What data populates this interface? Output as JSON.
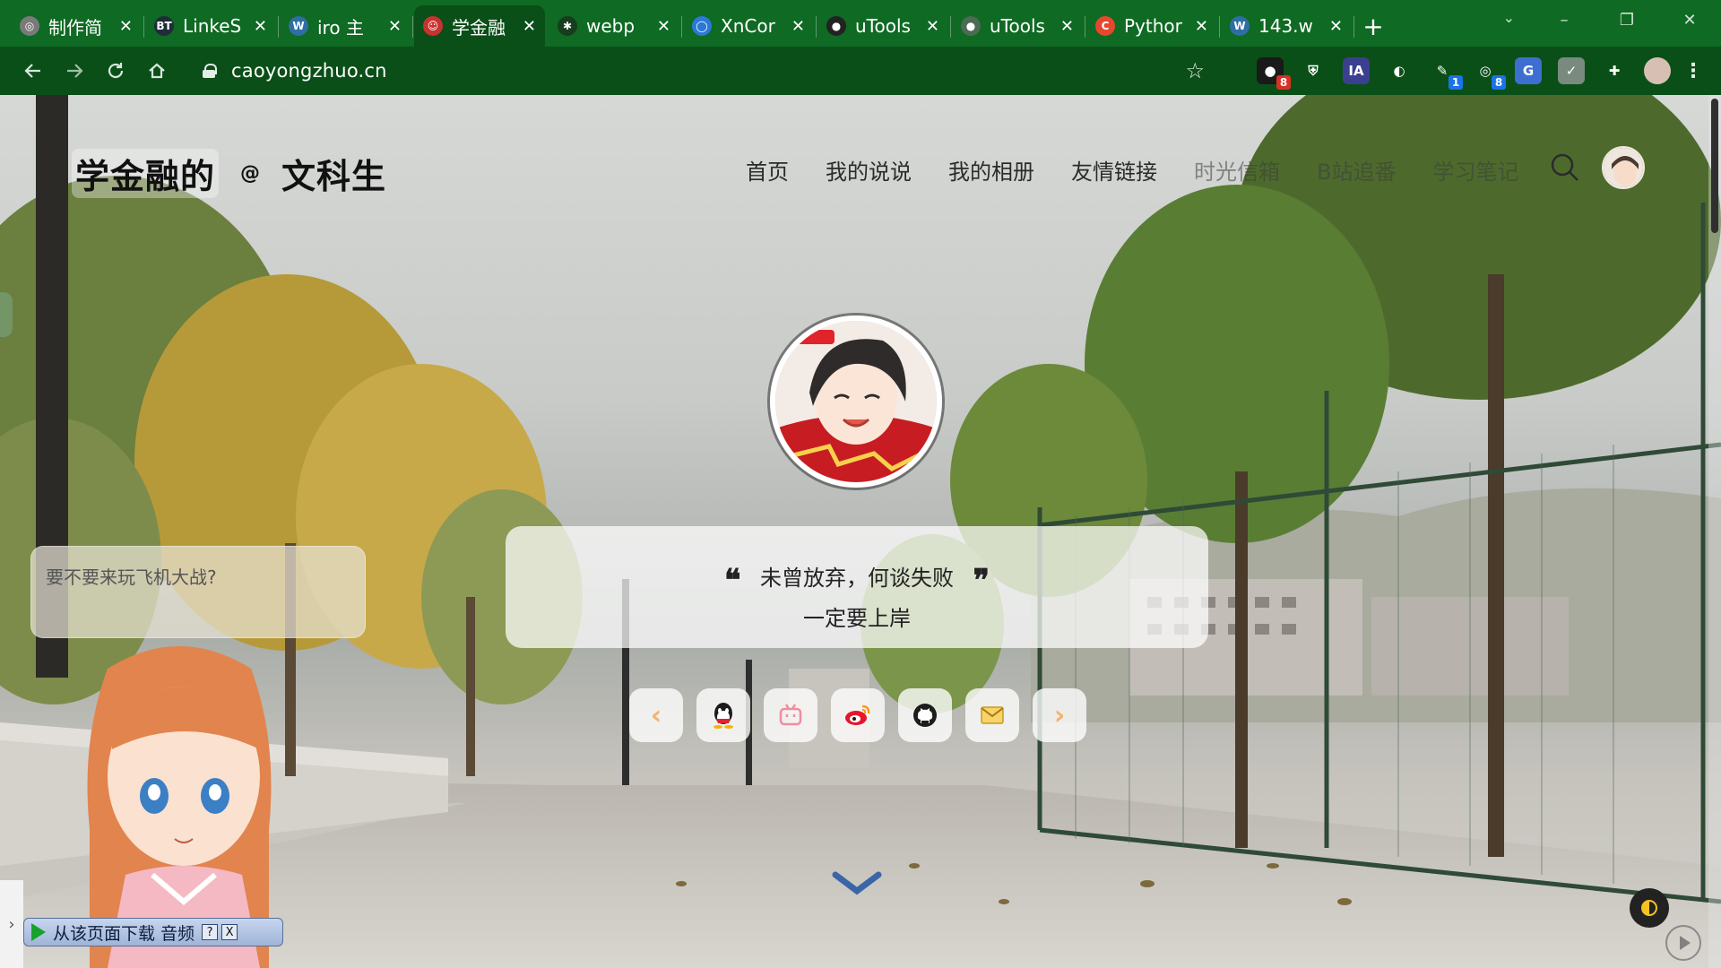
{
  "browser": {
    "tabs": [
      {
        "label": "制作简",
        "favicon": "globe-icon",
        "color": "#7a7a7a"
      },
      {
        "label": "LinkeS",
        "favicon": "bt-icon",
        "color": "#1f2d3a"
      },
      {
        "label": "iro 主",
        "favicon": "wordpress-icon",
        "color": "#2f6ea3"
      },
      {
        "label": "学金融",
        "favicon": "avatar-icon",
        "color": "#c8322f",
        "active": true
      },
      {
        "label": "webp",
        "favicon": "chain-icon",
        "color": "#173d1f"
      },
      {
        "label": "XnCor",
        "favicon": "xn-icon",
        "color": "#2a79d6"
      },
      {
        "label": "uTools",
        "favicon": "github-icon",
        "color": "#222222"
      },
      {
        "label": "uTools",
        "favicon": "github-icon",
        "color": "#4b6b53"
      },
      {
        "label": "Pythor",
        "favicon": "c-icon",
        "color": "#e5482e"
      },
      {
        "label": "143.w",
        "favicon": "wordpress-icon",
        "color": "#2f6ea3"
      }
    ],
    "new_tab_label": "+",
    "window_controls": [
      "–",
      "❐",
      "✕"
    ],
    "address": "caoyongzhuo.cn",
    "extensions": [
      {
        "name": "adblock-ext",
        "color": "#1a1a1a",
        "glyph": "●",
        "badge": "8",
        "badge_color": "#d93025"
      },
      {
        "name": "shield-ext",
        "color": "#0a4f18",
        "glyph": "⛨",
        "badge": ""
      },
      {
        "name": "ia-ext",
        "color": "#3b3f8f",
        "glyph": "IA",
        "badge": ""
      },
      {
        "name": "color-ext",
        "color": "#0a4f18",
        "glyph": "◐",
        "badge": ""
      },
      {
        "name": "key-ext",
        "color": "#0a4f18",
        "glyph": "✎",
        "badge": "1",
        "badge_color": "#1a73e8"
      },
      {
        "name": "cat-ext",
        "color": "#0a4f18",
        "glyph": "◎",
        "badge": "8",
        "badge_color": "#1a73e8"
      },
      {
        "name": "translate-ext",
        "color": "#3d6fd1",
        "glyph": "G",
        "badge": ""
      },
      {
        "name": "check-ext",
        "color": "#7a8a7f",
        "glyph": "✓",
        "badge": ""
      },
      {
        "name": "puzzle-ext",
        "color": "#0a4f18",
        "glyph": "✚",
        "badge": ""
      }
    ]
  },
  "site": {
    "logo": {
      "part1": "学金融的",
      "part2": "@",
      "part3": "文科生"
    },
    "nav": [
      {
        "label": "首页"
      },
      {
        "label": "我的说说"
      },
      {
        "label": "我的相册"
      },
      {
        "label": "友情链接"
      },
      {
        "label": "时光信箱"
      },
      {
        "label": "B站追番"
      },
      {
        "label": "学习笔记"
      }
    ],
    "quote": {
      "open": "❝",
      "text": "未曾放弃，何谈失败",
      "close": "❞",
      "subtitle": "一定要上岸"
    },
    "social": [
      {
        "name": "prev-arrow",
        "glyph": "‹"
      },
      {
        "name": "qq-icon"
      },
      {
        "name": "bilibili-icon"
      },
      {
        "name": "weibo-icon"
      },
      {
        "name": "github-icon"
      },
      {
        "name": "email-icon"
      },
      {
        "name": "next-arrow",
        "glyph": "›"
      }
    ],
    "chat_bubble": "要不要来玩飞机大战?",
    "audio_widget": {
      "label": "从该页面下载 音频",
      "help": "?",
      "close": "X"
    },
    "colors": {
      "accent_arrow": "#f3b36b",
      "down_chevron": "#3a66a8"
    }
  }
}
